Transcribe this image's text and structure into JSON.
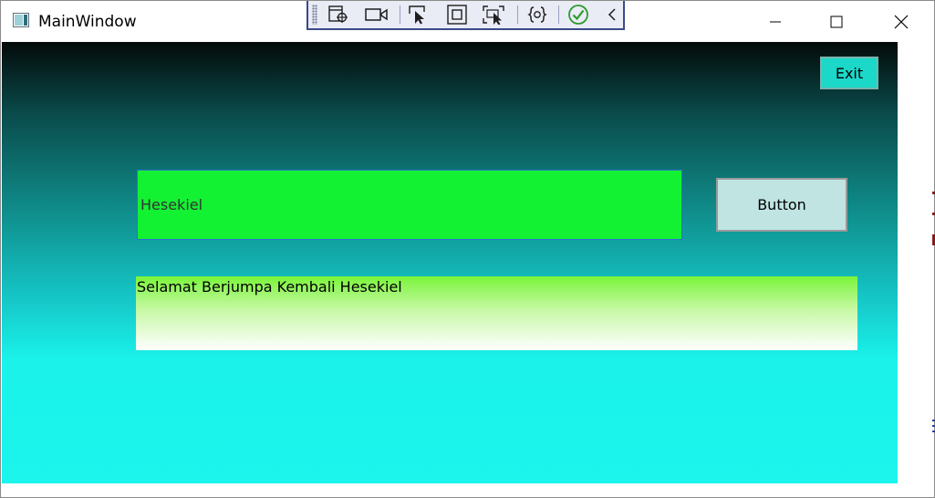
{
  "window": {
    "title": "MainWindow"
  },
  "debug_toolbar": {
    "items": [
      "select-element-icon",
      "record-video-icon",
      "select-cursor-icon",
      "display-layout-adorners-icon",
      "track-focus-icon",
      "binding-failures-icon",
      "check-icon",
      "collapse-chevron-icon"
    ]
  },
  "content": {
    "exit_label": "Exit",
    "name_value": "Hesekiel",
    "button_label": "Button",
    "greeting_text": "Selamat Berjumpa Kembali Hesekiel"
  },
  "colors": {
    "input_bg": "#12f232",
    "exit_bg": "#1cd8c9",
    "button_bg": "#bfe4e2",
    "gradient_top": "#030a09",
    "gradient_bottom": "#1bf5ec"
  }
}
